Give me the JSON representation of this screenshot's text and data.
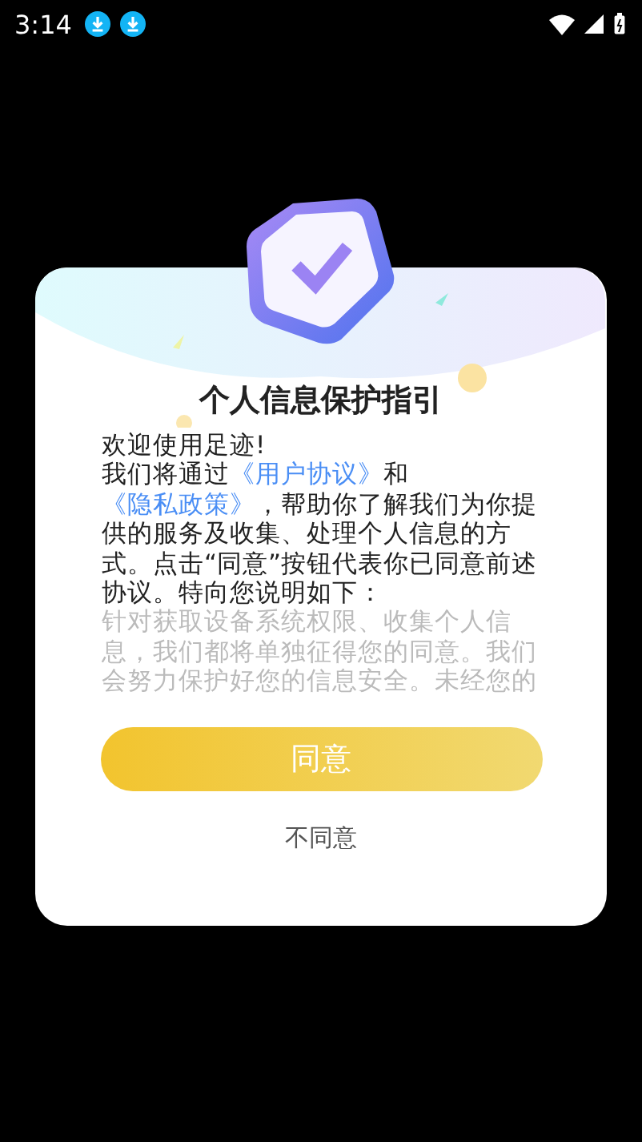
{
  "status_bar": {
    "time": "3:14"
  },
  "dialog": {
    "title": "个人信息保护指引",
    "greeting": "欢迎使用足迹!",
    "body": [
      {
        "kind": "text",
        "text": "我们将通过"
      },
      {
        "kind": "link",
        "text": "《用户协议》"
      },
      {
        "kind": "text",
        "text": "和"
      },
      {
        "kind": "link",
        "text": "《隐私政策》"
      },
      {
        "kind": "text",
        "text": "，帮助你了解我们为你提供的服务及收集、处理个人信息的方式。点击“同意”按钮代表你已同意前述协议。特向您说明如下："
      }
    ],
    "fine_print": "针对获取设备系统权限、收集个人信息，我们都将单独征得您的同意。我们会努力保护好您的信息安全。未经您的",
    "buttons": [
      {
        "kind": "primary",
        "label": "同意"
      },
      {
        "kind": "plain",
        "label": "不同意"
      }
    ]
  }
}
